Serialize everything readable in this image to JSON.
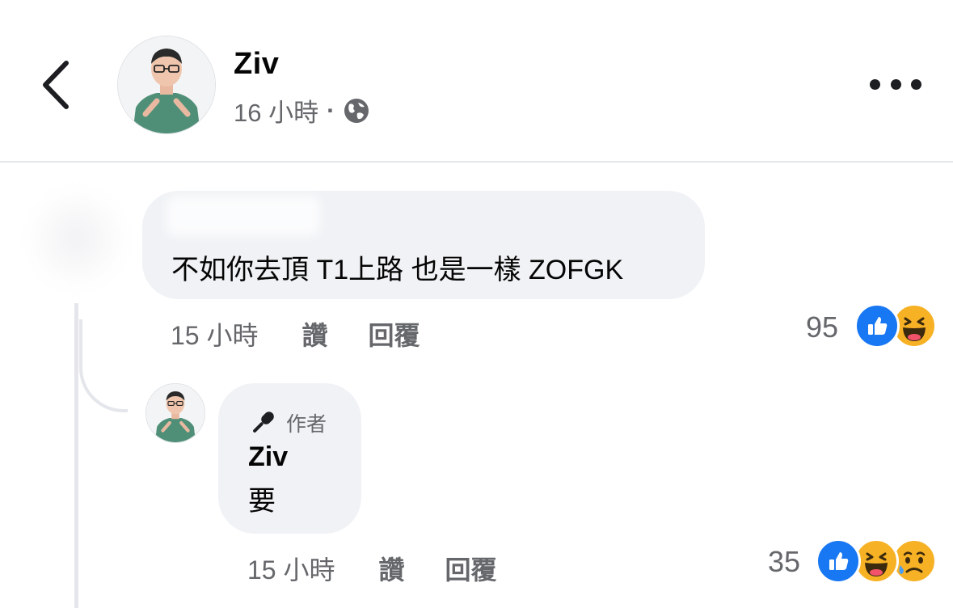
{
  "header": {
    "author_name": "Ziv",
    "post_time": "16 小時",
    "separator": "·",
    "privacy_icon": "globe-icon",
    "more_icon": "more-horizontal-icon",
    "back_icon": "chevron-left-icon"
  },
  "comment": {
    "text": "不如你去頂 T1上路 也是一樣 ZOFGK",
    "time": "15 小時",
    "like_label": "讚",
    "reply_label": "回覆",
    "reaction_count": "95",
    "reactions": [
      "like-icon",
      "haha-icon"
    ]
  },
  "reply": {
    "badge_label": "作者",
    "badge_icon": "microphone-icon",
    "author_name": "Ziv",
    "text": "要",
    "time": "15 小時",
    "like_label": "讚",
    "reply_label": "回覆",
    "reaction_count": "35",
    "reactions": [
      "like-icon",
      "haha-icon",
      "sad-icon"
    ]
  },
  "colors": {
    "bubble": "#f0f2f5",
    "like_blue": "#1877f2",
    "emoji_yellow": "#f7b125",
    "meta_gray": "#65676b",
    "shirt_green": "#4f8f78"
  }
}
